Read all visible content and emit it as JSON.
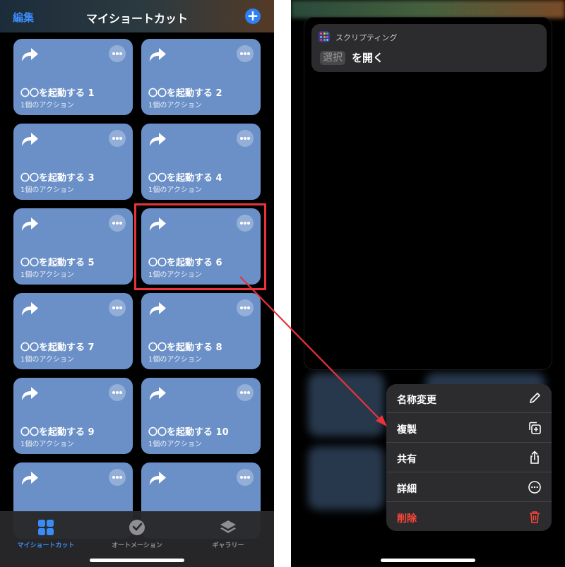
{
  "left": {
    "header": {
      "edit_label": "編集",
      "title": "マイショートカット",
      "add_label": "+"
    },
    "cards": [
      {
        "name": "〇〇を起動する 1",
        "sub": "1個のアクション"
      },
      {
        "name": "〇〇を起動する 2",
        "sub": "1個のアクション"
      },
      {
        "name": "〇〇を起動する 3",
        "sub": "1個のアクション"
      },
      {
        "name": "〇〇を起動する 4",
        "sub": "1個のアクション"
      },
      {
        "name": "〇〇を起動する 5",
        "sub": "1個のアクション"
      },
      {
        "name": "〇〇を起動する 6",
        "sub": "1個のアクション"
      },
      {
        "name": "〇〇を起動する 7",
        "sub": "1個のアクション"
      },
      {
        "name": "〇〇を起動する 8",
        "sub": "1個のアクション"
      },
      {
        "name": "〇〇を起動する 9",
        "sub": "1個のアクション"
      },
      {
        "name": "〇〇を起動する 10",
        "sub": "1個のアクション"
      },
      {
        "name": "",
        "sub": ""
      },
      {
        "name": "",
        "sub": ""
      }
    ],
    "card_color": "#6b90c8",
    "tabs": [
      {
        "label": "マイショートカット",
        "icon": "grid-icon",
        "active": true
      },
      {
        "label": "オートメーション",
        "icon": "clock-check-icon",
        "active": false
      },
      {
        "label": "ギャラリー",
        "icon": "layers-icon",
        "active": false
      }
    ]
  },
  "right": {
    "action": {
      "app_label": "スクリプティング",
      "token": "選択",
      "text": "を開く"
    },
    "menu": [
      {
        "label": "名称変更",
        "icon": "pencil-icon"
      },
      {
        "label": "複製",
        "icon": "duplicate-icon"
      },
      {
        "label": "共有",
        "icon": "share-icon"
      },
      {
        "label": "詳細",
        "icon": "ellipsis-circle-icon"
      },
      {
        "label": "削除",
        "icon": "trash-icon"
      }
    ]
  },
  "colors": {
    "accent": "#3b8bf7",
    "highlight": "#e8333b",
    "danger": "#ff453a"
  }
}
